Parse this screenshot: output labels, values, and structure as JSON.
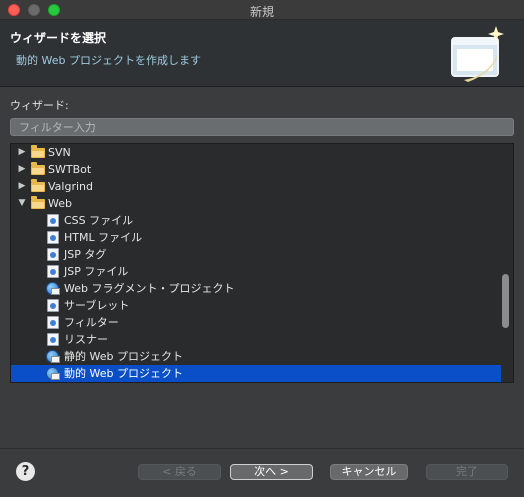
{
  "window": {
    "title": "新規"
  },
  "header": {
    "title": "ウィザードを選択",
    "description": "動的 Web プロジェクトを作成します"
  },
  "wizard_label": "ウィザード:",
  "filter": {
    "placeholder": "フィルター入力",
    "value": ""
  },
  "tree": {
    "items": [
      {
        "label": "SVN",
        "type": "folder",
        "expanded": false
      },
      {
        "label": "SWTBot",
        "type": "folder",
        "expanded": false
      },
      {
        "label": "Valgrind",
        "type": "folder",
        "expanded": false
      },
      {
        "label": "Web",
        "type": "folder",
        "expanded": true
      },
      {
        "label": "CSS ファイル",
        "type": "file"
      },
      {
        "label": "HTML ファイル",
        "type": "file"
      },
      {
        "label": "JSP タグ",
        "type": "file"
      },
      {
        "label": "JSP ファイル",
        "type": "file"
      },
      {
        "label": "Web フラグメント・プロジェクト",
        "type": "project"
      },
      {
        "label": "サーブレット",
        "type": "file"
      },
      {
        "label": "フィルター",
        "type": "file"
      },
      {
        "label": "リスナー",
        "type": "file"
      },
      {
        "label": "静的 Web プロジェクト",
        "type": "project"
      },
      {
        "label": "動的 Web プロジェクト",
        "type": "project",
        "selected": true
      }
    ]
  },
  "buttons": {
    "back": "< 戻る",
    "next": "次へ >",
    "cancel": "キャンセル",
    "finish": "完了"
  },
  "colors": {
    "selection": "#0a4fc7",
    "folder": "#e8b94a",
    "header_desc": "#9fcbe0"
  }
}
